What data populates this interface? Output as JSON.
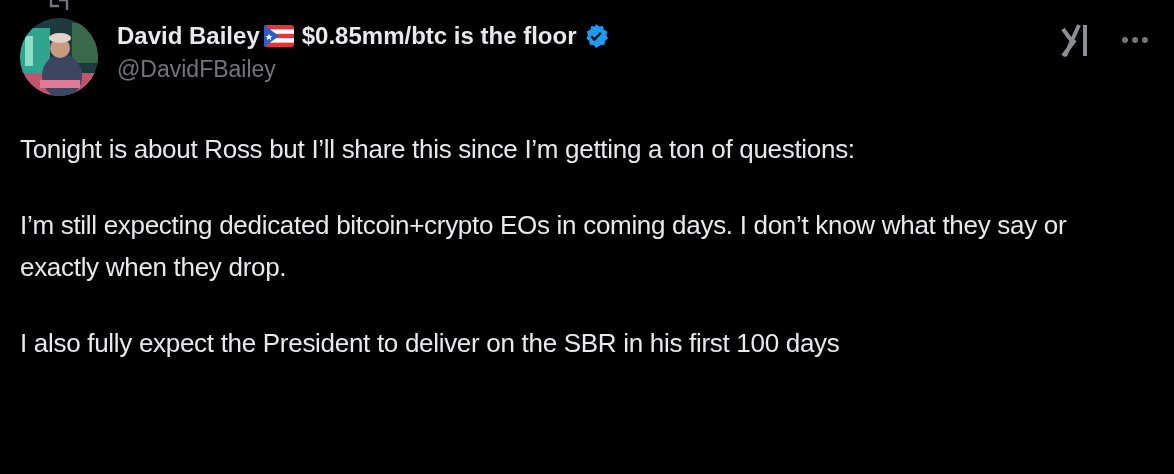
{
  "post": {
    "author": {
      "name": "David Bailey",
      "name_suffix": "$0.85mm/btc is the floor",
      "verified": true,
      "handle": "@DavidFBailey"
    },
    "paragraphs": [
      "Tonight is about Ross but I’ll share this since I’m getting a ton of questions:",
      "I’m still expecting dedicated bitcoin+crypto EOs in coming days. I don’t know what they say or exactly when they drop.",
      "I also fully expect the President to deliver on the SBR in his first 100 days"
    ]
  }
}
